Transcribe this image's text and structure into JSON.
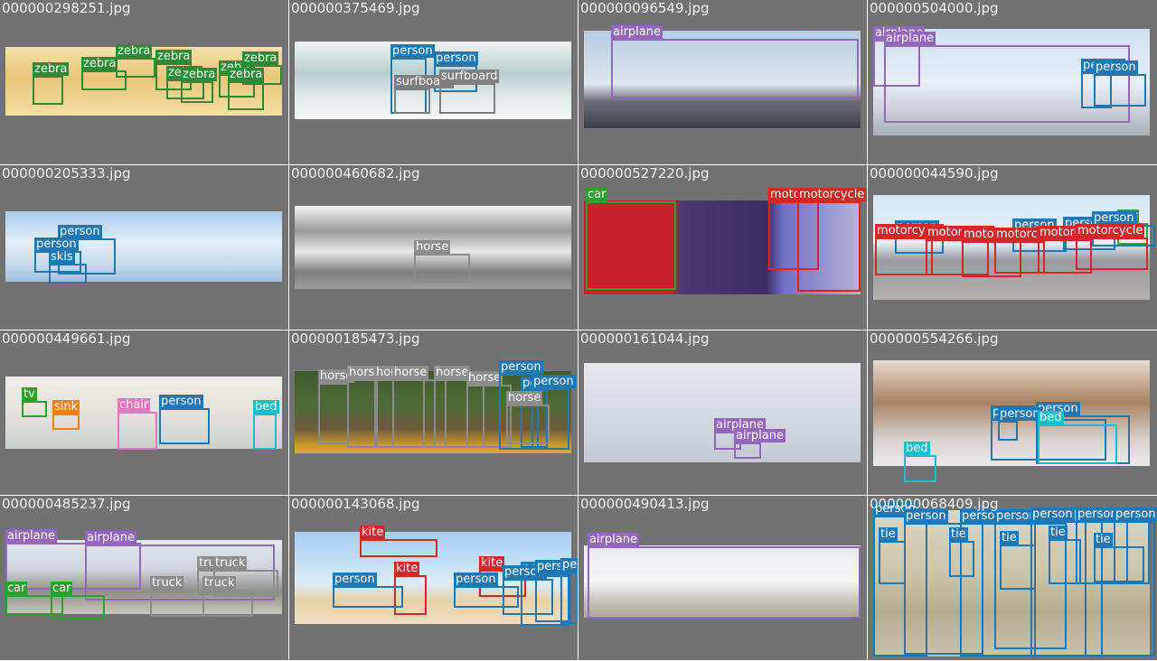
{
  "colors": {
    "zebra": "#2e8b35",
    "person": "#1f77b4",
    "surfboard": "#7f7f7f",
    "airplane": "#9467bd",
    "skis": "#1f77b4",
    "horse": "#8c8c8c",
    "car": "#2ca02c",
    "motorcycle": "#d62728",
    "tv": "#2ca02c",
    "sink": "#ff7f0e",
    "chair": "#e377c2",
    "bed": "#17becf",
    "truck": "#8c8c8c",
    "kite": "#d62728",
    "tie": "#1f77b4"
  },
  "tiles": [
    {
      "filename": "000000298251.jpg",
      "background": "linear-gradient(180deg,#f3e2a8 0%,#e9c67a 45%,#f4dfa0 100%)",
      "detections": [
        {
          "label": "zebra",
          "cls": "zebra"
        },
        {
          "label": "zebra",
          "cls": "zebra"
        },
        {
          "label": "zebra",
          "cls": "zebra"
        },
        {
          "label": "zebra",
          "cls": "zebra"
        },
        {
          "label": "zebra",
          "cls": "zebra"
        },
        {
          "label": "zebra",
          "cls": "zebra"
        },
        {
          "label": "zebra",
          "cls": "zebra"
        },
        {
          "label": "zebra",
          "cls": "zebra"
        },
        {
          "label": "zebra",
          "cls": "zebra"
        }
      ]
    },
    {
      "filename": "000000375469.jpg",
      "background": "linear-gradient(180deg,#eef3f3 0%,#b9cfcf 40%,#dfe9e9 70%,#f6f6f6 100%)",
      "detections": [
        {
          "label": "person",
          "cls": "person"
        },
        {
          "label": "person",
          "cls": "person"
        },
        {
          "label": "surfboard",
          "cls": "surfboard"
        },
        {
          "label": "surfboard",
          "cls": "surfboard"
        }
      ]
    },
    {
      "filename": "000000096549.jpg",
      "background": "linear-gradient(180deg,#b6cbe6 0%,#dfe6ee 55%,#6d6f78 72%,#3c3f4a 100%)",
      "detections": [
        {
          "label": "airplane",
          "cls": "airplane"
        }
      ]
    },
    {
      "filename": "000000504000.jpg",
      "background": "linear-gradient(180deg,#cfe1f4 0%,#e8eef4 50%,#cfd3d9 75%,#a9aeb6 100%)",
      "detections": [
        {
          "label": "airplane",
          "cls": "airplane"
        },
        {
          "label": "airplane",
          "cls": "airplane"
        },
        {
          "label": "person",
          "cls": "person"
        },
        {
          "label": "person",
          "cls": "person"
        }
      ]
    },
    {
      "filename": "000000205333.jpg",
      "background": "linear-gradient(180deg,#a9cdee 0%,#e3eef7 45%,#c6dbee 75%,#9fbfe0 100%)",
      "detections": [
        {
          "label": "person",
          "cls": "person"
        },
        {
          "label": "person",
          "cls": "person"
        },
        {
          "label": "skis",
          "cls": "skis"
        }
      ]
    },
    {
      "filename": "000000460682.jpg",
      "background": "linear-gradient(180deg,#f4f4f4 0%,#9a9a9a 30%,#e9e9e9 55%,#7d7d7d 80%,#9d9d9d 100%)",
      "detections": [
        {
          "label": "horse",
          "cls": "horse"
        }
      ]
    },
    {
      "filename": "000000527220.jpg",
      "background": "linear-gradient(90deg,#c8222d 0%,#c8222d 32%,#4b3a70 35%,#3a2e63 66%,#6f6fc5 72%,#b8b4d6 100%)",
      "detections": [
        {
          "label": "car",
          "cls": "car"
        },
        {
          "label": "motorcycle",
          "cls": "motorcycle"
        },
        {
          "label": "motorcycle",
          "cls": "motorcycle"
        }
      ]
    },
    {
      "filename": "000000044590.jpg",
      "background": "linear-gradient(180deg,#d3e6f7 0%,#e8f1f8 45%,#9b9aa0 62%,#b4b1ad 100%)",
      "detections": [
        {
          "label": "person",
          "cls": "person"
        },
        {
          "label": "person",
          "cls": "person"
        },
        {
          "label": "person",
          "cls": "person"
        },
        {
          "label": "car",
          "cls": "car"
        },
        {
          "label": "person",
          "cls": "person"
        },
        {
          "label": "motorcycle",
          "cls": "motorcycle"
        },
        {
          "label": "motorcycle",
          "cls": "motorcycle"
        },
        {
          "label": "motorcycle",
          "cls": "motorcycle"
        },
        {
          "label": "motorcycle",
          "cls": "motorcycle"
        },
        {
          "label": "motorcycle",
          "cls": "motorcycle"
        },
        {
          "label": "motorcycle",
          "cls": "motorcycle"
        }
      ]
    },
    {
      "filename": "000000449661.jpg",
      "background": "linear-gradient(180deg,#f1ede8 0%,#e3e0db 55%,#c9d2ce 100%)",
      "detections": [
        {
          "label": "tv",
          "cls": "tv"
        },
        {
          "label": "sink",
          "cls": "sink"
        },
        {
          "label": "chair",
          "cls": "chair"
        },
        {
          "label": "person",
          "cls": "person"
        },
        {
          "label": "bed",
          "cls": "bed"
        }
      ]
    },
    {
      "filename": "000000185473.jpg",
      "background": "linear-gradient(180deg,#3f5b2e 0%,#4d6b38 40%,#6e5a3c 70%,#c79b2a 90%,#d6a834 100%)",
      "detections": [
        {
          "label": "horse",
          "cls": "horse"
        },
        {
          "label": "horse",
          "cls": "horse"
        },
        {
          "label": "horse",
          "cls": "horse"
        },
        {
          "label": "horse",
          "cls": "horse"
        },
        {
          "label": "horse",
          "cls": "horse"
        },
        {
          "label": "horse",
          "cls": "horse"
        },
        {
          "label": "person",
          "cls": "person"
        },
        {
          "label": "person",
          "cls": "person"
        },
        {
          "label": "person",
          "cls": "person"
        },
        {
          "label": "horse",
          "cls": "horse"
        }
      ]
    },
    {
      "filename": "000000161044.jpg",
      "background": "linear-gradient(180deg,#e6e9ee 0%,#d3d8df 60%,#c4c9d1 100%)",
      "detections": [
        {
          "label": "airplane",
          "cls": "airplane"
        },
        {
          "label": "airplane",
          "cls": "airplane"
        }
      ]
    },
    {
      "filename": "000000554266.jpg",
      "background": "linear-gradient(180deg,#ead9cb 0%,#a78463 40%,#d7d1cf 75%,#ecebed 100%)",
      "detections": [
        {
          "label": "person",
          "cls": "person"
        },
        {
          "label": "person",
          "cls": "person"
        },
        {
          "label": "person",
          "cls": "person"
        },
        {
          "label": "bed",
          "cls": "bed"
        },
        {
          "label": "bed",
          "cls": "bed"
        }
      ]
    },
    {
      "filename": "000000485237.jpg",
      "background": "linear-gradient(180deg,#e3e8ee 0%,#cfd4da 40%,#8f8f86 70%,#c9c8bc 100%)",
      "detections": [
        {
          "label": "airplane",
          "cls": "airplane"
        },
        {
          "label": "airplane",
          "cls": "airplane"
        },
        {
          "label": "truck",
          "cls": "truck"
        },
        {
          "label": "car",
          "cls": "car"
        },
        {
          "label": "car",
          "cls": "car"
        },
        {
          "label": "truck",
          "cls": "truck"
        },
        {
          "label": "truck",
          "cls": "truck"
        },
        {
          "label": "truck",
          "cls": "truck"
        }
      ]
    },
    {
      "filename": "000000143068.jpg",
      "background": "linear-gradient(180deg,#a5cdf0 0%,#d9ecfa 55%,#e7d2a9 75%,#f2dcc0 100%)",
      "detections": [
        {
          "label": "kite",
          "cls": "kite"
        },
        {
          "label": "kite",
          "cls": "kite"
        },
        {
          "label": "kite",
          "cls": "kite"
        },
        {
          "label": "person",
          "cls": "person"
        },
        {
          "label": "person",
          "cls": "person"
        },
        {
          "label": "person",
          "cls": "person"
        },
        {
          "label": "person",
          "cls": "person"
        },
        {
          "label": "person",
          "cls": "person"
        },
        {
          "label": "person",
          "cls": "person"
        }
      ]
    },
    {
      "filename": "000000490413.jpg",
      "background": "linear-gradient(180deg,#e8eaf0 0%,#f6f6f7 50%,#c9c6bc 75%,#a9a69b 100%)",
      "detections": [
        {
          "label": "airplane",
          "cls": "airplane"
        }
      ]
    },
    {
      "filename": "000000068409.jpg",
      "background": "linear-gradient(180deg,#d8d6c4 0%,#cbc8ad 40%,#b2ae92 70%,#c7c3ab 100%)",
      "detections": [
        {
          "label": "person",
          "cls": "person"
        },
        {
          "label": "person",
          "cls": "person"
        },
        {
          "label": "person",
          "cls": "person"
        },
        {
          "label": "person",
          "cls": "person"
        },
        {
          "label": "person",
          "cls": "person"
        },
        {
          "label": "person",
          "cls": "person"
        },
        {
          "label": "person",
          "cls": "person"
        },
        {
          "label": "person",
          "cls": "person"
        },
        {
          "label": "tie",
          "cls": "tie"
        },
        {
          "label": "tie",
          "cls": "tie"
        },
        {
          "label": "tie",
          "cls": "tie"
        },
        {
          "label": "tie",
          "cls": "tie"
        },
        {
          "label": "tie",
          "cls": "tie"
        }
      ]
    }
  ]
}
